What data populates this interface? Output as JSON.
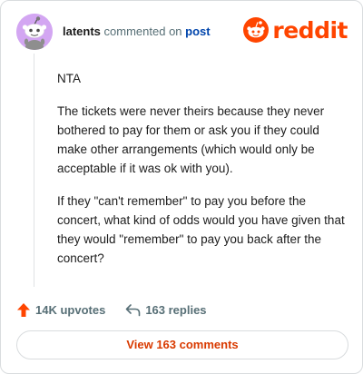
{
  "comment": {
    "username": "latents",
    "meta_text": "commented on",
    "post_link": "post",
    "paragraphs": [
      "NTA",
      "The tickets were never theirs because they never bothered to pay for them or ask you if they could make other arrangements (which would only be acceptable if it was ok with you).",
      "If they \"can't remember\" to pay you before the concert, what kind of odds would you have given that they would \"remember\" to pay you back after the concert?"
    ]
  },
  "logo": {
    "text": "reddit"
  },
  "actions": {
    "upvotes": "14K upvotes",
    "replies": "163 replies"
  },
  "view_button": "View 163 comments",
  "colors": {
    "brand": "#ff4500",
    "link": "#0045ac",
    "button_text": "#d93a00",
    "upvote": "#ff4500",
    "avatar_bg": "#d3a6f2"
  },
  "icons": {
    "avatar": "snoo-avatar",
    "logo": "reddit-snoo-icon",
    "upvote": "upvote-arrow-icon",
    "reply": "reply-arrow-icon"
  }
}
